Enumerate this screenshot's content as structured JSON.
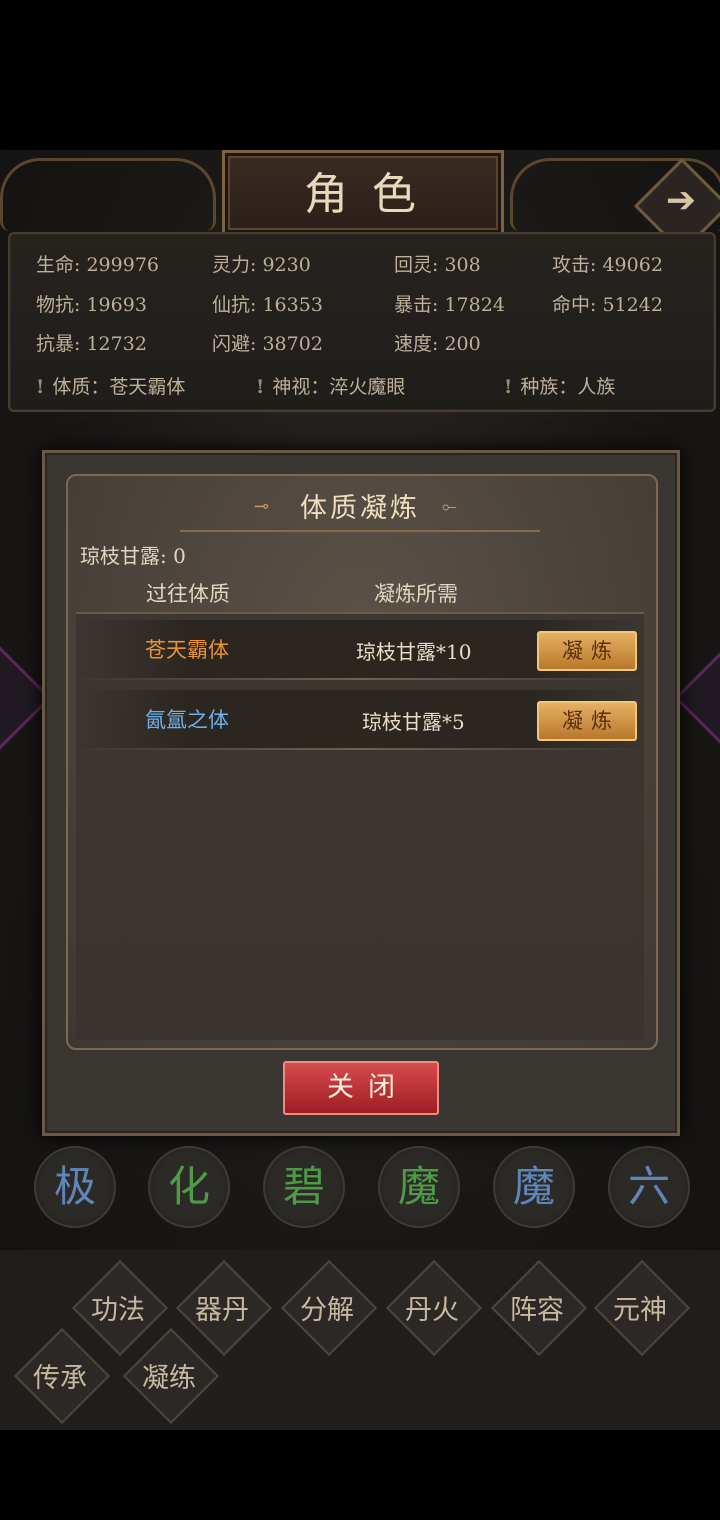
{
  "header": {
    "title": "角色",
    "arrow": "➔"
  },
  "stats": [
    {
      "label": "生命",
      "value": "299976"
    },
    {
      "label": "灵力",
      "value": "9230"
    },
    {
      "label": "回灵",
      "value": "308"
    },
    {
      "label": "攻击",
      "value": "49062"
    },
    {
      "label": "物抗",
      "value": "19693"
    },
    {
      "label": "仙抗",
      "value": "16353"
    },
    {
      "label": "暴击",
      "value": "17824"
    },
    {
      "label": "命中",
      "value": "51242"
    },
    {
      "label": "抗暴",
      "value": "12732"
    },
    {
      "label": "闪避",
      "value": "38702"
    },
    {
      "label": "速度",
      "value": "200"
    }
  ],
  "traits": [
    {
      "label": "体质",
      "value": "苍天霸体"
    },
    {
      "label": "神视",
      "value": "淬火魔眼"
    },
    {
      "label": "种族",
      "value": "人族"
    }
  ],
  "modal": {
    "title": "体质凝炼",
    "currency_label": "琼枝甘露",
    "currency_value": "0",
    "col_past": "过往体质",
    "col_cost": "凝炼所需",
    "rows": [
      {
        "name": "苍天霸体",
        "cost": "琼枝甘露*10",
        "button": "凝炼",
        "name_color": "#e8923a"
      },
      {
        "name": "氤氲之体",
        "cost": "琼枝甘露*5",
        "button": "凝炼",
        "name_color": "#6fb0e6"
      }
    ],
    "close_label": "关闭"
  },
  "chars": [
    {
      "text": "极",
      "color": "#5f86b8"
    },
    {
      "text": "化",
      "color": "#4f9a46"
    },
    {
      "text": "碧",
      "color": "#4f9a46"
    },
    {
      "text": "魔",
      "color": "#4f9a46"
    },
    {
      "text": "魔",
      "color": "#5f86b8"
    },
    {
      "text": "六",
      "color": "#5f86b8"
    }
  ],
  "nav": [
    "功法",
    "器丹",
    "分解",
    "丹火",
    "阵容",
    "元神",
    "传承",
    "凝练"
  ]
}
